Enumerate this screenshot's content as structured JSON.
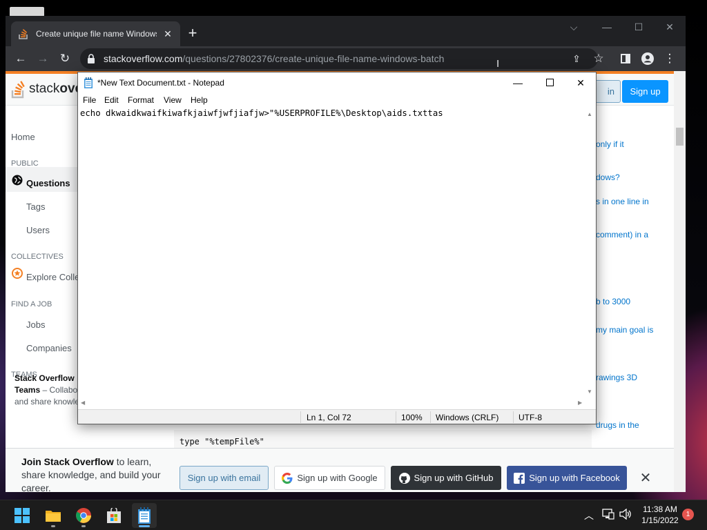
{
  "browser": {
    "tab_title": "Create unique file name Windows batch",
    "tab_close": "✕",
    "new_tab": "+",
    "url_domain": "stackoverflow.com",
    "url_path": "/questions/27802376/create-unique-file-name-windows-batch"
  },
  "so": {
    "logo_text_light": "stack",
    "logo_text_bold": "ove",
    "login": "in",
    "signup": "Sign up",
    "nav": {
      "home": "Home",
      "public": "PUBLIC",
      "questions": "Questions",
      "tags": "Tags",
      "users": "Users",
      "collectives": "COLLECTIVES",
      "explore": "Explore Colle",
      "find_job": "FIND A JOB",
      "jobs": "Jobs",
      "companies": "Companies",
      "teams": "TEAMS"
    },
    "teams_title": "Stack Overflow",
    "teams_bold": "Teams",
    "teams_rest": " – Collabo",
    "teams_line3": "and share knowledge",
    "side_snippets": [
      "only if it",
      "dows?",
      "s in one line in",
      "comment) in a",
      "b to 3000",
      "my main goal is",
      "rawings 3D",
      "drugs in the"
    ],
    "code_line": "type \"%tempFile%\"",
    "join_bold": "Join Stack Overflow",
    "join_rest": " to learn, share knowledge, and build your career.",
    "btn_email": "Sign up with email",
    "btn_google": "Sign up with Google",
    "btn_github": "Sign up with GitHub",
    "btn_facebook": "Sign up with Facebook",
    "dismiss": "✕"
  },
  "notepad": {
    "title": "*New Text Document.txt - Notepad",
    "menu": [
      "File",
      "Edit",
      "Format",
      "View",
      "Help"
    ],
    "content": "echo dkwaidkwaifkiwafkjaiwfjwfjiafjw>\"%USERPROFILE%\\Desktop\\aids.txttas",
    "status": {
      "position": "Ln 1, Col 72",
      "zoom": "100%",
      "line_ending": "Windows (CRLF)",
      "encoding": "UTF-8"
    }
  },
  "taskbar": {
    "time": "11:38 AM",
    "date": "1/15/2022",
    "notifications": "1"
  },
  "colors": {
    "so_orange": "#f48024",
    "so_blue": "#0a95ff",
    "chrome_dark": "#202124",
    "facebook": "#385499",
    "github": "#2f3337"
  }
}
